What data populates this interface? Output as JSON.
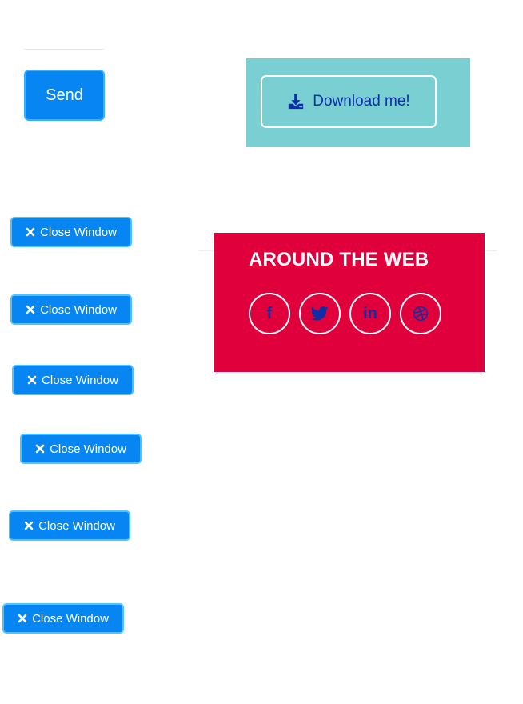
{
  "form": {
    "send_label": "Send"
  },
  "download": {
    "label": "Download me!",
    "icon": "download-icon"
  },
  "around_the_web": {
    "title": "AROUND THE WEB",
    "social": [
      {
        "name": "facebook",
        "icon": "facebook-icon",
        "glyph": "f"
      },
      {
        "name": "twitter",
        "icon": "twitter-icon"
      },
      {
        "name": "linkedin",
        "icon": "linkedin-icon",
        "glyph": "in"
      },
      {
        "name": "dribbble",
        "icon": "dribbble-icon"
      }
    ]
  },
  "modals": {
    "close_buttons": [
      {
        "label": "Close Window",
        "icon": "close-icon"
      },
      {
        "label": "Close Window",
        "icon": "close-icon"
      },
      {
        "label": "Close Window",
        "icon": "close-icon"
      },
      {
        "label": "Close Window",
        "icon": "close-icon"
      },
      {
        "label": "Close Window",
        "icon": "close-icon"
      },
      {
        "label": "Close Window",
        "icon": "close-icon"
      }
    ]
  },
  "colors": {
    "primary_button": "#0785f2",
    "teal_panel": "#7acfd3",
    "web_panel": "#e0003b",
    "icon_blue": "#0b2fa6"
  }
}
